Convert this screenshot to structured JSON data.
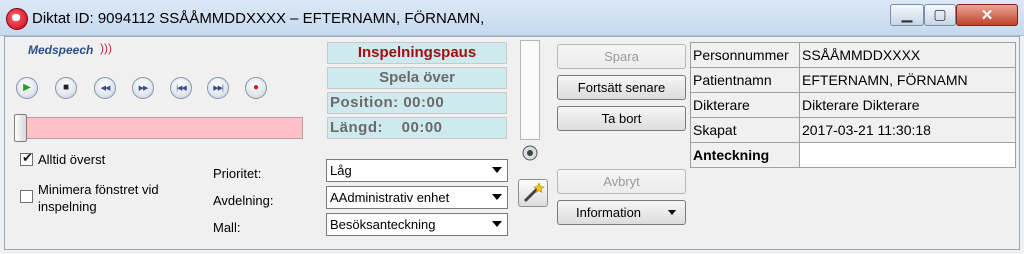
{
  "window": {
    "title": "Diktat ID: 9094112  SSÅÅMMDDXXXX – EFTERNAMN, FÖRNAMN,",
    "minimize_label": "▁",
    "maximize_label": "▢",
    "close_label": "✕"
  },
  "brand": {
    "logo_text": "Medspeech"
  },
  "transport": {
    "controls": [
      {
        "name": "play",
        "icon": "play-icon",
        "glyph": "▶",
        "color": "#2a9a2a"
      },
      {
        "name": "stop",
        "icon": "stop-icon",
        "glyph": "■",
        "color": "#222222"
      },
      {
        "name": "rewind",
        "icon": "rewind-icon",
        "glyph": "◀◀",
        "color": "#3a4e8a"
      },
      {
        "name": "fast-forward",
        "icon": "fast-forward-icon",
        "glyph": "▶▶",
        "color": "#3a4e8a"
      },
      {
        "name": "skip-start",
        "icon": "skip-to-start-icon",
        "glyph": "|◀◀",
        "color": "#3a4e8a"
      },
      {
        "name": "skip-end",
        "icon": "skip-to-end-icon",
        "glyph": "▶▶|",
        "color": "#3a4e8a"
      },
      {
        "name": "record",
        "icon": "record-icon",
        "glyph": "●",
        "color": "#d01c1c"
      }
    ],
    "progress_fraction": 0.0
  },
  "options": {
    "always_on_top_label": "Alltid överst",
    "always_on_top_checked": true,
    "minimize_line1": "Minimera fönstret vid",
    "minimize_line2": "inspelning",
    "minimize_checked": false
  },
  "status": {
    "state": "Inspelningspaus",
    "state_color": "#a01010",
    "replay": "Spela över",
    "position": "Position: 00:00",
    "length": "Längd:    00:00"
  },
  "fields": {
    "priority_label": "Prioritet:",
    "priority_value": "Låg",
    "department_label": "Avdelning:",
    "department_value": "AAdministrativ enhet",
    "template_label": "Mall:",
    "template_value": "Besöksanteckning"
  },
  "buttons": {
    "save": "Spara",
    "continue_later": "Fortsätt senare",
    "delete": "Ta bort",
    "cancel": "Avbryt",
    "information": "Information"
  },
  "info_rows": [
    {
      "key": "Personnummer",
      "value": "SSÅÅMMDDXXXX"
    },
    {
      "key": "Patientnamn",
      "value": " EFTERNAMN, FÖRNAMN"
    },
    {
      "key": "Dikterare",
      "value": "Dikterare Dikterare"
    },
    {
      "key": "Skapat",
      "value": "2017-03-21 11:30:18"
    },
    {
      "key": "Anteckning",
      "value": ""
    }
  ]
}
